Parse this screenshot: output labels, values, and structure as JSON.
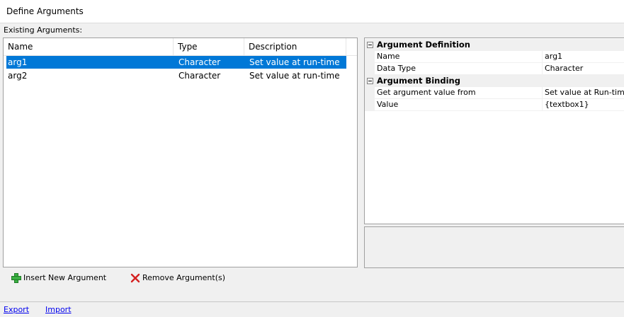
{
  "window": {
    "title": "Define Arguments"
  },
  "existing_label": "Existing Arguments:",
  "arguments_table": {
    "columns": [
      "Name",
      "Type",
      "Description"
    ],
    "rows": [
      {
        "name": "arg1",
        "type": "Character",
        "description": "Set value at run-time",
        "selected": true
      },
      {
        "name": "arg2",
        "type": "Character",
        "description": "Set value at run-time",
        "selected": false
      }
    ],
    "selection_color": "#0078d7"
  },
  "property_grid": {
    "categories": [
      {
        "label": "Argument Definition",
        "properties": [
          {
            "name": "Name",
            "value": "arg1"
          },
          {
            "name": "Data Type",
            "value": "Character"
          }
        ]
      },
      {
        "label": "Argument Binding",
        "properties": [
          {
            "name": "Get argument value from",
            "value": "Set value at Run-time"
          },
          {
            "name": "Value",
            "value": "{textbox1}"
          }
        ]
      }
    ]
  },
  "actions": {
    "insert_label": "Insert New Argument",
    "insert_icon": "green-plus-icon",
    "remove_label": "Remove Argument(s)",
    "remove_icon": "red-x-icon"
  },
  "footer": {
    "export_label": "Export",
    "import_label": "Import"
  }
}
